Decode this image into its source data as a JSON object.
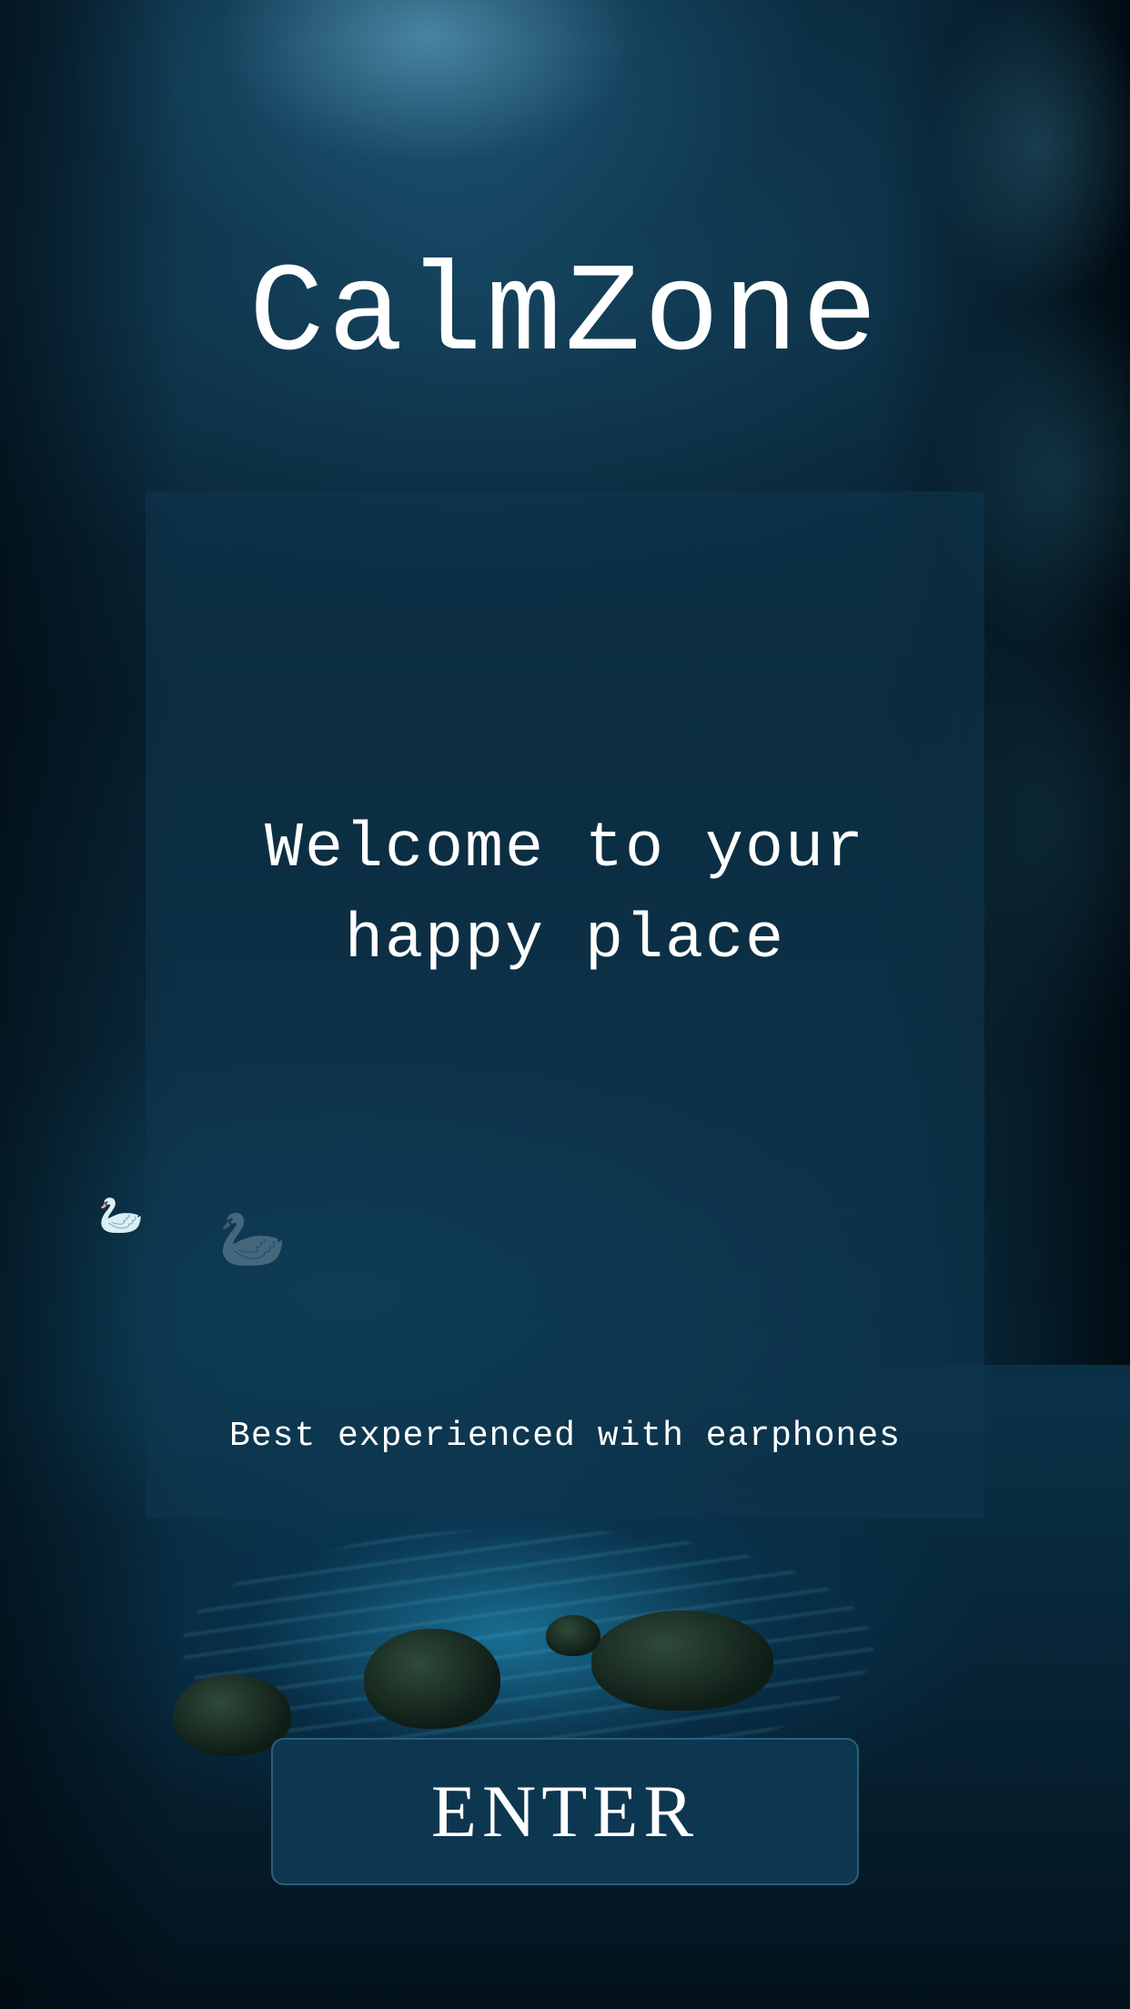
{
  "app": {
    "title": "CalmZone"
  },
  "card": {
    "welcome_text": "Welcome to your\nhappy place",
    "hint_text": "Best experienced with earphones"
  },
  "actions": {
    "enter_label": "ENTER"
  },
  "colors": {
    "background_dark": "#02121c",
    "card_overlay": "#0e364e",
    "button_fill": "#0d3650",
    "text": "#ffffff"
  }
}
